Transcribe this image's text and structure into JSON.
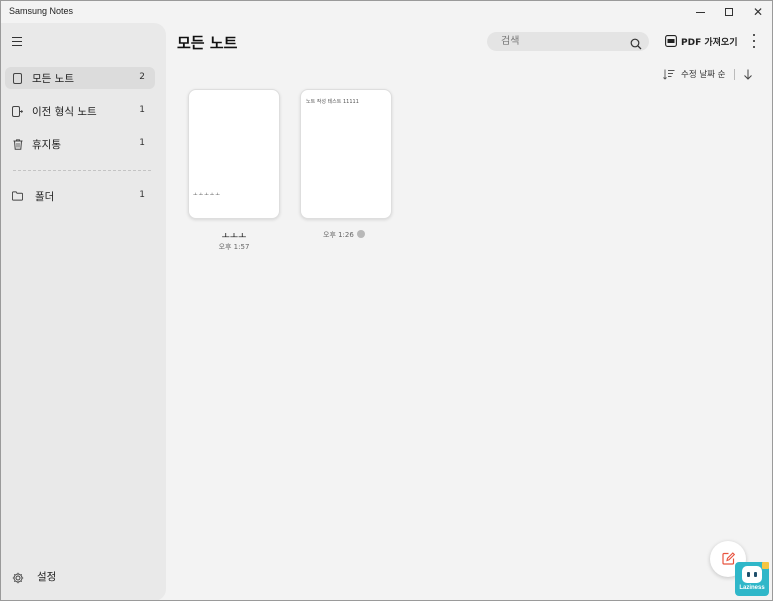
{
  "window": {
    "title": "Samsung Notes"
  },
  "sidebar": {
    "items": [
      {
        "label": "모든 노트",
        "count": "2"
      },
      {
        "label": "이전 형식 노트",
        "count": "1"
      },
      {
        "label": "휴지통",
        "count": "1"
      },
      {
        "label": "폴더",
        "count": "1"
      }
    ],
    "settings_label": "설정"
  },
  "main": {
    "title": "모든 노트",
    "search_placeholder": "검색",
    "pdf_import_label": "PDF 가져오기",
    "sort_label": "수정 날짜 순"
  },
  "notes": [
    {
      "title": "ㅗㅗㅗ",
      "preview": "ㅗㅗㅗㅗㅗ",
      "time": "오후 1:57"
    },
    {
      "title": "",
      "preview": "노트 작성 테스트 11111",
      "time": "오후 1:26"
    }
  ],
  "badge": {
    "text": "Laziness"
  },
  "colors": {
    "background": "#f3f3f3",
    "sidebar": "#e9e9e9",
    "active_item": "#dcdcdc",
    "fab_icon": "#e8533f",
    "badge": "#2fb7c9"
  },
  "icons": {
    "menu": "hamburger-icon",
    "all_notes": "note-icon",
    "legacy_notes": "legacy-note-icon",
    "trash": "trash-icon",
    "folder": "folder-icon",
    "settings": "gear-icon",
    "search": "search-icon",
    "pdf": "pdf-icon",
    "more": "more-vertical-icon",
    "sort": "sort-icon",
    "sort_direction": "arrow-down-icon",
    "new_note": "edit-icon"
  }
}
